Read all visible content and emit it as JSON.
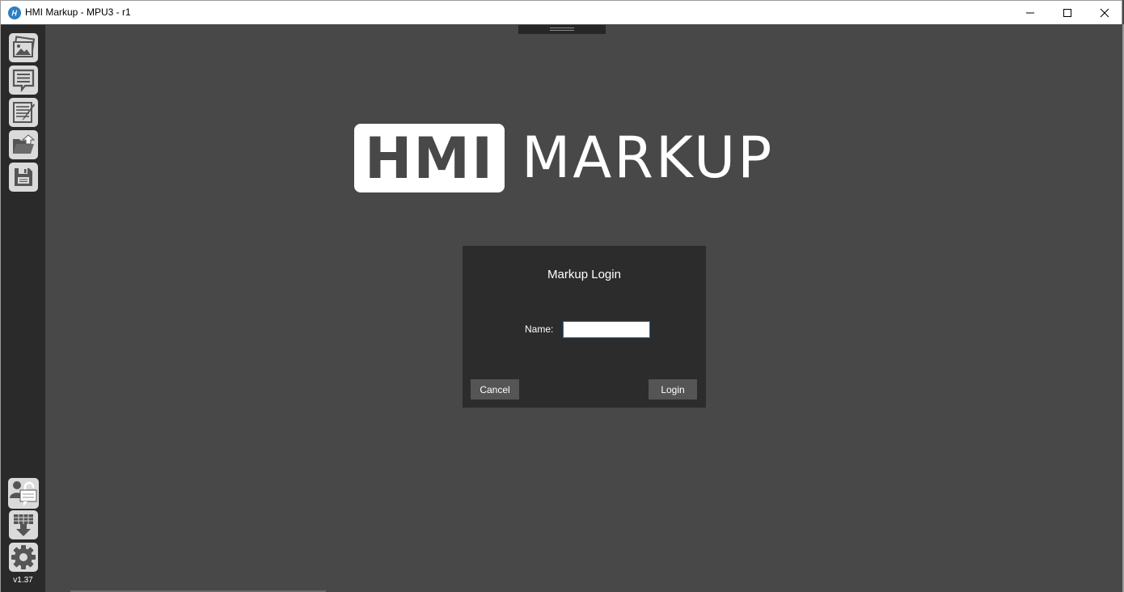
{
  "window": {
    "title": "HMI Markup - MPU3 - r1",
    "app_icon": "hmi-markup-logo-icon",
    "controls": [
      "minimize-icon",
      "maximize-icon",
      "close-icon"
    ]
  },
  "sidebar": {
    "top_buttons": [
      {
        "name": "images",
        "icon": "image-gallery-icon"
      },
      {
        "name": "comments",
        "icon": "comment-list-icon"
      },
      {
        "name": "notes",
        "icon": "notepad-icon"
      },
      {
        "name": "open",
        "icon": "open-folder-icon"
      },
      {
        "name": "save",
        "icon": "floppy-disk-icon"
      }
    ],
    "bottom_buttons": [
      {
        "name": "user-login",
        "icon": "user-unlock-icon"
      },
      {
        "name": "download",
        "icon": "download-icon"
      },
      {
        "name": "settings",
        "icon": "gear-icon"
      }
    ],
    "version": "v1.37"
  },
  "logo": {
    "boxed_text": "HMI",
    "text": "MARKUP"
  },
  "login_dialog": {
    "title": "Markup Login",
    "name_label": "Name:",
    "name_value": "",
    "cancel_label": "Cancel",
    "login_label": "Login"
  },
  "colors": {
    "background": "#484848",
    "sidebar": "#2a2a2a",
    "dialog": "#2c2c2c",
    "button": "#555555",
    "icon_tile": "#dadada",
    "input_focus": "#0078d7"
  }
}
